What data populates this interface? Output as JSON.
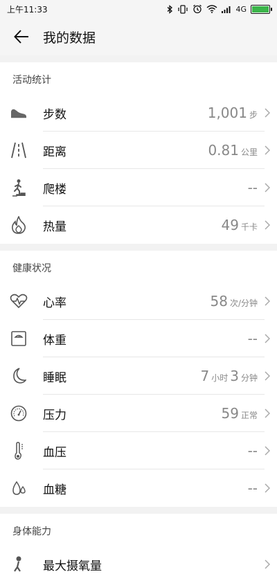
{
  "status": {
    "time": "上午11:33",
    "network": "4G"
  },
  "header": {
    "title": "我的数据"
  },
  "sections": [
    {
      "title": "活动统计",
      "items": [
        {
          "label": "步数",
          "value": "1,001",
          "unit": "步",
          "icon": "shoe-icon"
        },
        {
          "label": "距离",
          "value": "0.81",
          "unit": "公里",
          "icon": "road-icon"
        },
        {
          "label": "爬楼",
          "value": "--",
          "unit": "",
          "icon": "stairs-icon"
        },
        {
          "label": "热量",
          "value": "49",
          "unit": "千卡",
          "icon": "flame-icon"
        }
      ]
    },
    {
      "title": "健康状况",
      "items": [
        {
          "label": "心率",
          "value": "58",
          "unit": "次/分钟",
          "icon": "heart-rate-icon"
        },
        {
          "label": "体重",
          "value": "--",
          "unit": "",
          "icon": "scale-icon"
        },
        {
          "label": "睡眠",
          "value_h": "7",
          "unit_h": "小时",
          "value_m": "3",
          "unit_m": "分钟",
          "icon": "moon-icon"
        },
        {
          "label": "压力",
          "value": "59",
          "unit": "正常",
          "icon": "gauge-icon"
        },
        {
          "label": "血压",
          "value": "--",
          "unit": "",
          "icon": "thermometer-icon"
        },
        {
          "label": "血糖",
          "value": "--",
          "unit": "",
          "icon": "drops-icon"
        }
      ]
    },
    {
      "title": "身体能力",
      "items": [
        {
          "label": "最大摄氧量",
          "value": "",
          "unit": "",
          "icon": "runner-icon"
        }
      ]
    }
  ]
}
